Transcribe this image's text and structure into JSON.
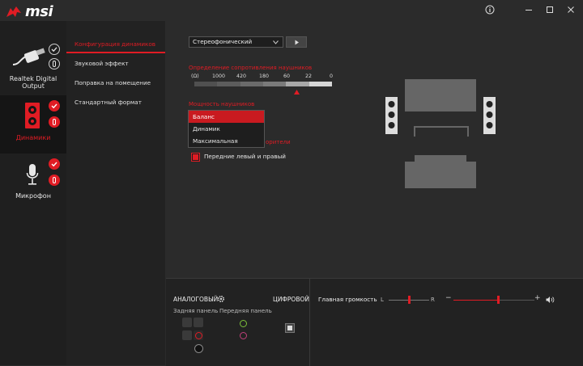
{
  "app": {
    "brand": "msi"
  },
  "window": {
    "info_icon": "info-icon",
    "min_icon": "minimize-icon",
    "max_icon": "maximize-icon",
    "close_icon": "close-icon"
  },
  "devices": [
    {
      "label": "Realtek Digital Output",
      "icon": "spdif-cable-icon",
      "active": false
    },
    {
      "label": "Динамики",
      "icon": "speaker-icon",
      "active": true
    },
    {
      "label": "Микрофон",
      "icon": "microphone-icon",
      "active": false
    }
  ],
  "tabs": [
    {
      "label": "Конфигурация динамиков",
      "active": true
    },
    {
      "label": "Звуковой эффект",
      "active": false
    },
    {
      "label": "Поправка на помещение",
      "active": false
    },
    {
      "label": "Стандартный формат",
      "active": false
    }
  ],
  "speaker_config": {
    "select_value": "Стереофонический",
    "impedance_label": "Определение сопротивления наушников",
    "impedance_unit": "(Ω)",
    "impedance_ticks": [
      "1000",
      "420",
      "180",
      "60",
      "22",
      "0"
    ],
    "power_label": "Мощность наушников",
    "power_options": [
      "Баланс",
      "Динамик",
      "Максимальная"
    ],
    "power_selected": "Баланс",
    "partial_label": "орители",
    "checkbox_label": "Передние левый и правый",
    "checkbox_checked": true
  },
  "connectors": {
    "analog_label": "АНАЛОГОВЫЙ",
    "digital_label": "ЦИФРОВОЙ",
    "rear_label": "Задняя панель",
    "front_label": "Передняя панель"
  },
  "volume": {
    "label": "Главная громкость",
    "left": "L",
    "right": "R",
    "minus": "−",
    "plus": "+",
    "balance": 0.5,
    "level": 0.55
  },
  "colors": {
    "accent": "#e01c24",
    "green_jack": "#7cbf3a",
    "pink_jack": "#c0407a"
  }
}
